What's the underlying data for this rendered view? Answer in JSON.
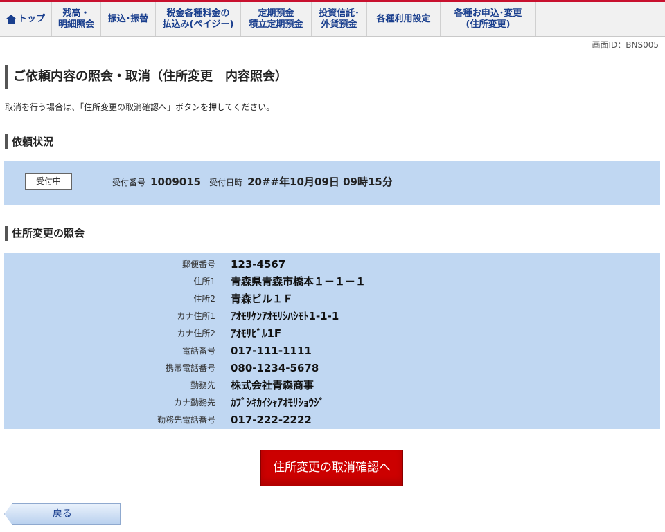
{
  "nav": {
    "items": [
      {
        "label": "トップ"
      },
      {
        "label": "残高・\n明細照会"
      },
      {
        "label": "振込･振替"
      },
      {
        "label": "税金各種料金の\n払込み(ペイジー)"
      },
      {
        "label": "定期預金\n積立定期預金"
      },
      {
        "label": "投資信託･\n外貨預金"
      },
      {
        "label": "各種利用設定"
      },
      {
        "label": "各種お申込･変更\n(住所変更)"
      }
    ]
  },
  "screen_id": "画面ID：BNS005",
  "title": "ご依頼内容の照会・取消（住所変更　内容照会）",
  "instruction": "取消を行う場合は、「住所変更の取消確認へ」ボタンを押してください。",
  "status_section": {
    "heading": "依頼状況",
    "badge": "受付中",
    "receipt_label": "受付番号",
    "receipt_value": "1009015",
    "date_label": "受付日時",
    "date_value": "20##年10月09日 09時15分"
  },
  "detail_section": {
    "heading": "住所変更の照会",
    "rows": [
      {
        "label": "郵便番号",
        "value": "123-4567"
      },
      {
        "label": "住所1",
        "value": "青森県青森市橋本１－１－１"
      },
      {
        "label": "住所2",
        "value": "青森ビル１Ｆ"
      },
      {
        "label": "カナ住所1",
        "value": "ｱｵﾓﾘｹﾝｱｵﾓﾘｼﾊｼﾓﾄ1-1-1"
      },
      {
        "label": "カナ住所2",
        "value": "ｱｵﾓﾘﾋﾞﾙ1F"
      },
      {
        "label": "電話番号",
        "value": "017-111-1111"
      },
      {
        "label": "携帯電話番号",
        "value": "080-1234-5678"
      },
      {
        "label": "勤務先",
        "value": "株式会社青森商事"
      },
      {
        "label": "カナ勤務先",
        "value": "ｶﾌﾞｼｷｶｲｼｬｱｵﾓﾘｼｮｳｼﾞ"
      },
      {
        "label": "勤務先電話番号",
        "value": "017-222-2222"
      }
    ]
  },
  "cancel_button": "住所変更の取消確認へ",
  "back_button": "戻る",
  "colors": {
    "accent": "#c8102e",
    "panel": "#c0d7f2",
    "nav_text": "#1a3f8e",
    "cancel": "#cc0000"
  }
}
